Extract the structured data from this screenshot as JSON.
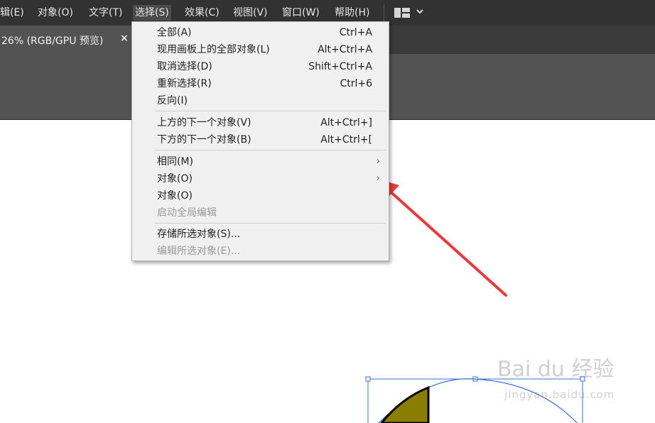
{
  "menubar": {
    "items": [
      "辑(E)",
      "对象(O)",
      "文字(T)",
      "选择(S)",
      "效果(C)",
      "视图(V)",
      "窗口(W)",
      "帮助(H)"
    ],
    "workspace_icon": "workspace-layout-icon",
    "chevron_icon": "chevron-down-icon"
  },
  "tab": {
    "title": "26% (RGB/GPU 预览)",
    "close": "×"
  },
  "dropdown": {
    "items": [
      {
        "label": "全部(A)",
        "shortcut": "Ctrl+A"
      },
      {
        "label": "现用画板上的全部对象(L)",
        "shortcut": "Alt+Ctrl+A"
      },
      {
        "label": "取消选择(D)",
        "shortcut": "Shift+Ctrl+A"
      },
      {
        "label": "重新选择(R)",
        "shortcut": "Ctrl+6"
      },
      {
        "label": "反向(I)",
        "shortcut": ""
      },
      {
        "label": "上方的下一个对象(V)",
        "shortcut": "Alt+Ctrl+]"
      },
      {
        "label": "下方的下一个对象(B)",
        "shortcut": "Alt+Ctrl+["
      },
      {
        "label": "相同(M)",
        "submenu": true
      },
      {
        "label": "对象(O)",
        "submenu": true
      },
      {
        "label": "对象(O)",
        "submenu": false
      },
      {
        "label": "启动全局编辑",
        "disabled": true
      },
      {
        "label": "存储所选对象(S)..."
      },
      {
        "label": "编辑所选对象(E)...",
        "disabled": true
      }
    ],
    "submenu_arrow": "›"
  },
  "canvas": {
    "shape_fill": "#8b7d00",
    "arc_color": "#3a6fd8",
    "arrow_color": "#e8393b"
  },
  "watermark": {
    "line1": "Bai du 经验",
    "line2": "jingyan.baidu.com"
  }
}
